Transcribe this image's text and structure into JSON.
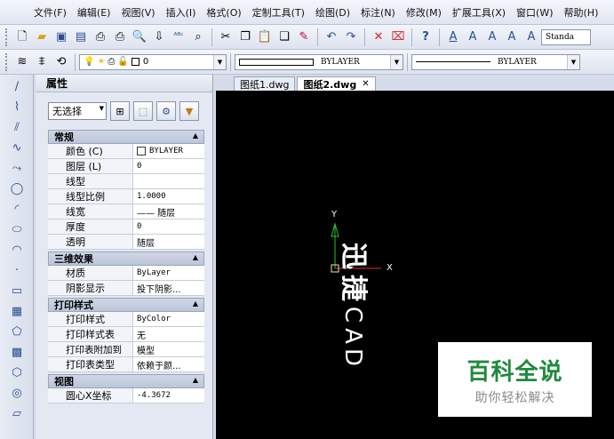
{
  "menu": [
    "文件(F)",
    "编辑(E)",
    "视图(V)",
    "插入(I)",
    "格式(O)",
    "定制工具(T)",
    "绘图(D)",
    "标注(N)",
    "修改(M)",
    "扩展工具(X)",
    "窗口(W)",
    "帮助(H)"
  ],
  "toolbar": {
    "text_style": "Standa",
    "layer_value": "0",
    "color_value": "BYLAYER",
    "linetype_value": "BYLAYER"
  },
  "properties": {
    "title": "属性",
    "selection": "无选择",
    "sections": [
      {
        "label": "常规",
        "rows": [
          {
            "k": "颜色 (C)",
            "v": "BYLAYER",
            "swatch": true
          },
          {
            "k": "图层 (L)",
            "v": "0"
          },
          {
            "k": "线型",
            "v": ""
          },
          {
            "k": "线型比例",
            "v": "1.0000"
          },
          {
            "k": "线宽",
            "v": "—— 随层"
          },
          {
            "k": "厚度",
            "v": "0"
          },
          {
            "k": "透明",
            "v": "随层"
          }
        ]
      },
      {
        "label": "三维效果",
        "rows": [
          {
            "k": "材质",
            "v": "ByLayer"
          },
          {
            "k": "阴影显示",
            "v": "投下阴影..."
          }
        ]
      },
      {
        "label": "打印样式",
        "rows": [
          {
            "k": "打印样式",
            "v": "ByColor"
          },
          {
            "k": "打印样式表",
            "v": "无"
          },
          {
            "k": "打印表附加到",
            "v": "模型"
          },
          {
            "k": "打印表类型",
            "v": "依赖于颜..."
          }
        ]
      },
      {
        "label": "视图",
        "rows": [
          {
            "k": "圆心X坐标",
            "v": "-4.3672"
          }
        ]
      }
    ]
  },
  "tabs": [
    {
      "label": "图纸1.dwg",
      "active": false
    },
    {
      "label": "图纸2.dwg",
      "active": true,
      "close": "✕"
    }
  ],
  "canvas": {
    "ucs_y": "Y",
    "ucs_x": "X",
    "bold_text": [
      "迅",
      "捷"
    ],
    "thin_text": [
      "C",
      "A",
      "D"
    ]
  },
  "watermark": {
    "line1": "百科全说",
    "line2": "助你轻松解决"
  },
  "colors": {
    "canvas_bg": "#000000",
    "ucs_green": "#29c22f",
    "ucs_red": "#e03030",
    "badge_green": "#1f8a3c"
  }
}
